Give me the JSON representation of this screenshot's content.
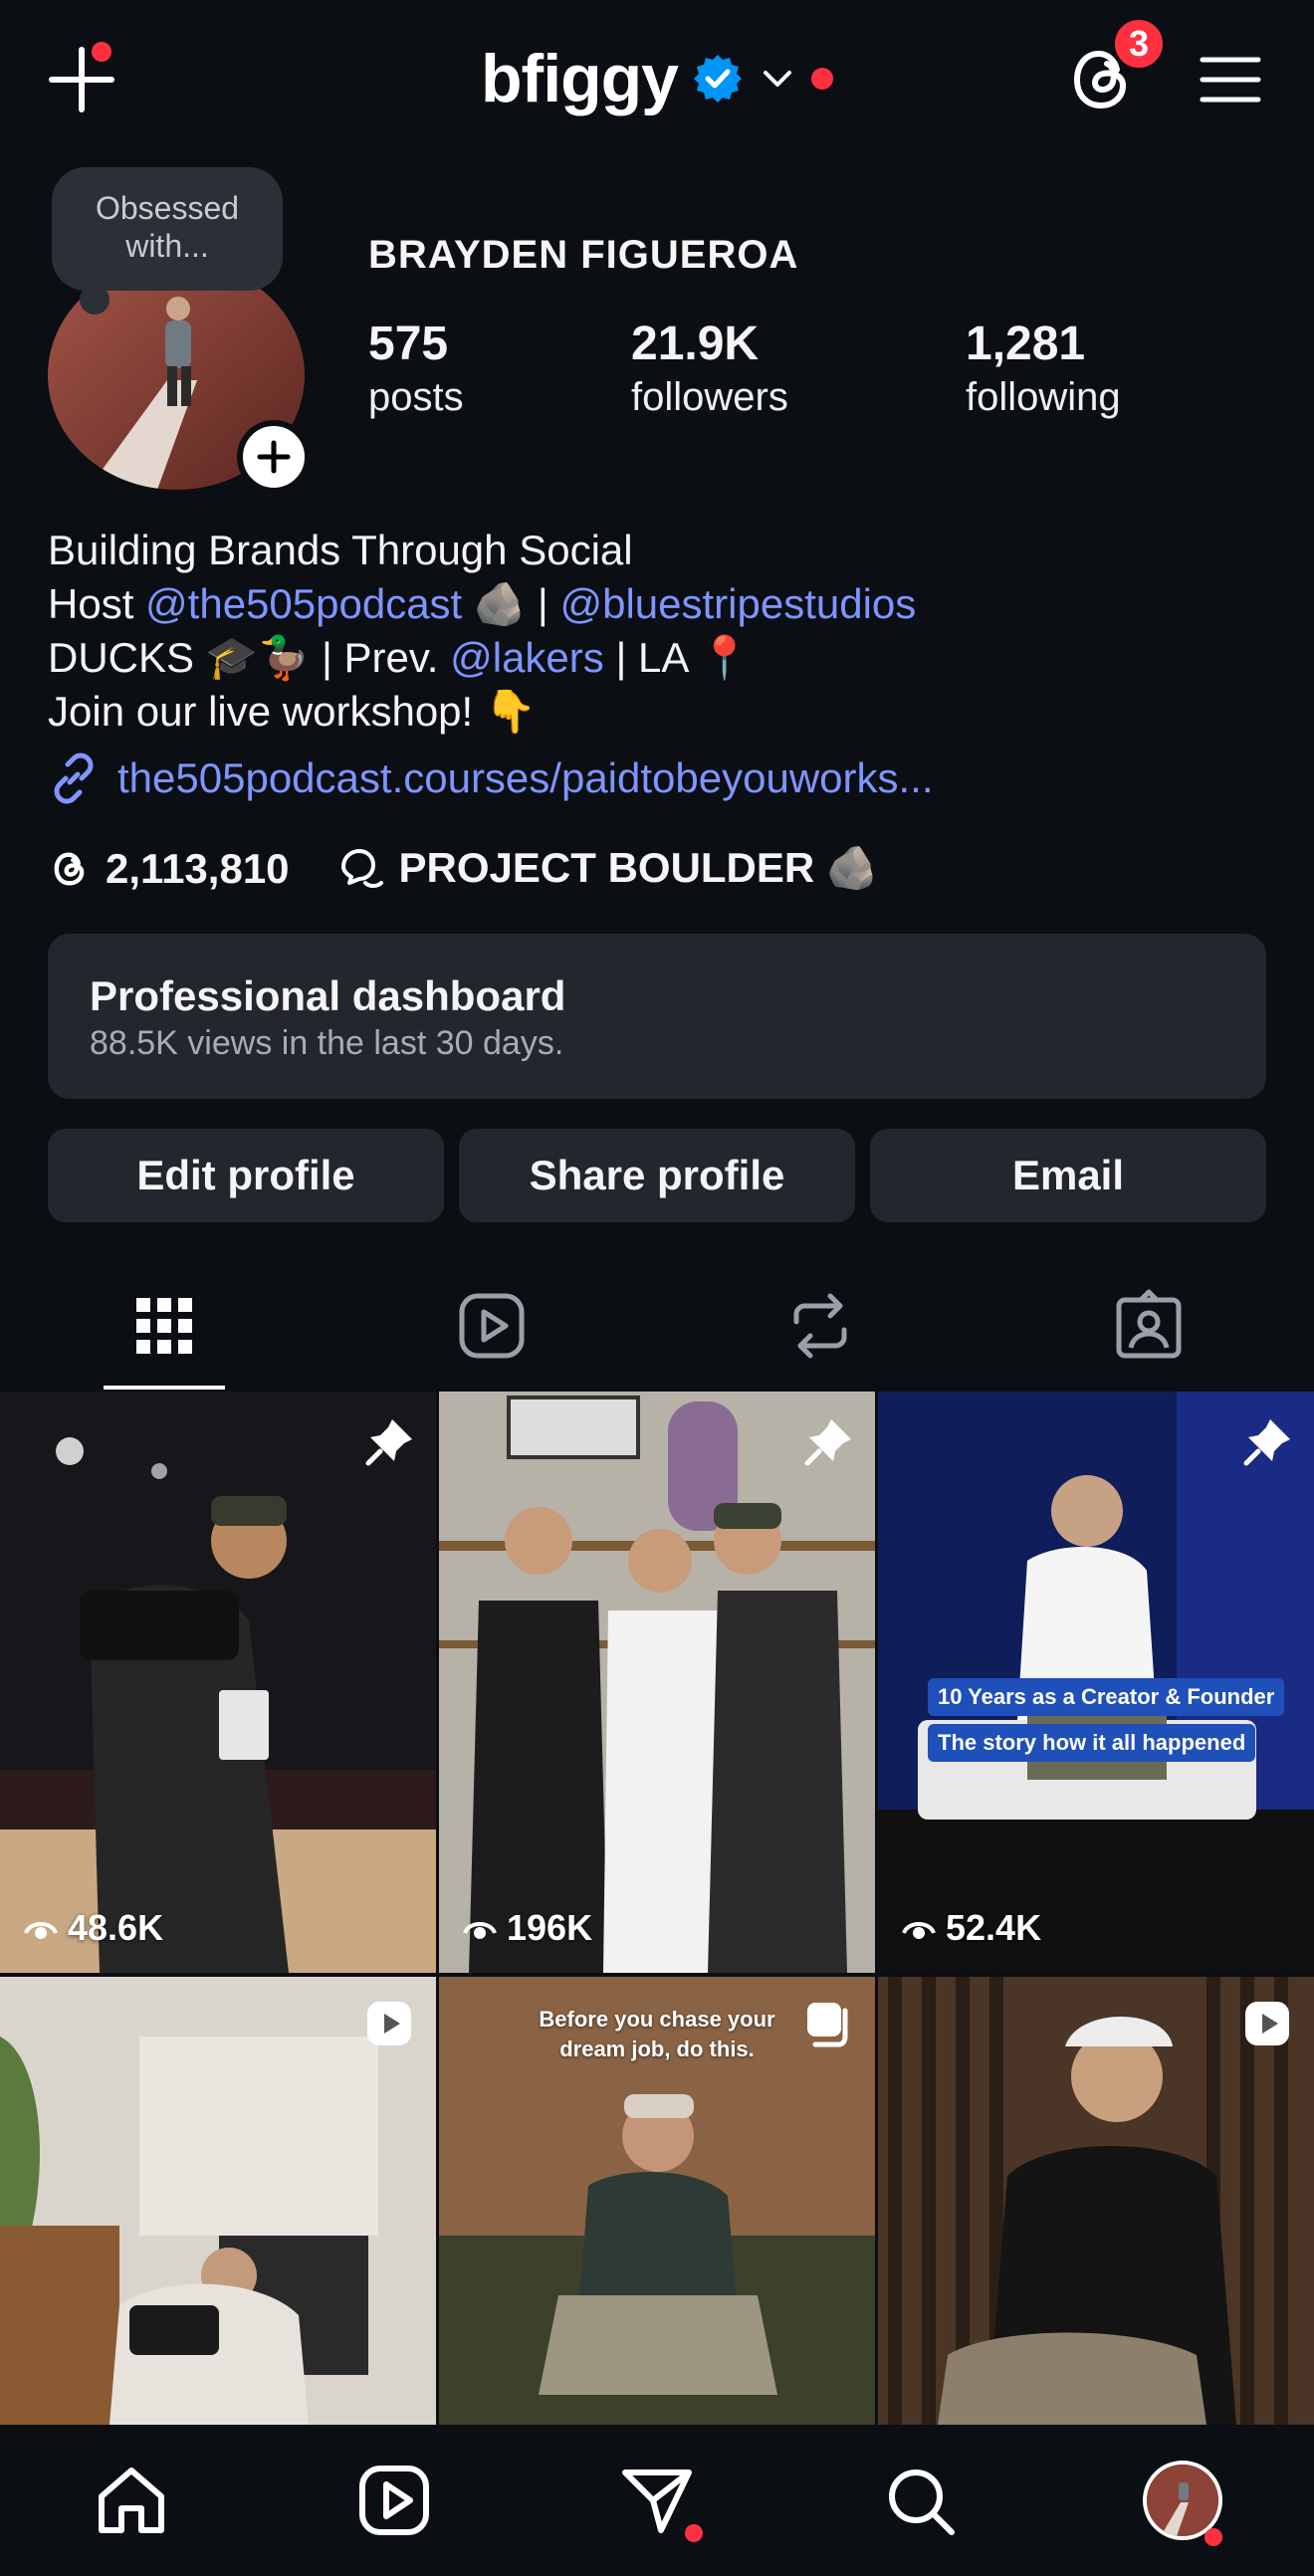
{
  "header": {
    "username": "bfiggy",
    "notification_count": "3",
    "icons": [
      "plus-icon",
      "verified-badge-icon",
      "chevron-down-icon",
      "threads-icon",
      "hamburger-menu-icon"
    ]
  },
  "profile": {
    "note": "Obsessed with...",
    "full_name": "BRAYDEN FIGUEROA",
    "stats": {
      "posts_count": "575",
      "posts_label": "posts",
      "followers_count": "21.9K",
      "followers_label": "followers",
      "following_count": "1,281",
      "following_label": "following"
    }
  },
  "bio": {
    "line1": "Building Brands Through Social",
    "line2_prefix": "Host ",
    "line2_link1": "@the505podcast",
    "line2_emoji1": "🪨",
    "line2_sep": " | ",
    "line2_link2": "@bluestripestudios",
    "line3_prefix": "DUCKS 🎓🦆 | Prev. ",
    "line3_link": "@lakers",
    "line3_suffix": " | LA 📍",
    "line4": "Join our live workshop! 👇",
    "url": "the505podcast.courses/paidtobeyouworks...",
    "threads_count": "2,113,810",
    "channel_name": "PROJECT BOULDER 🪨"
  },
  "dashboard": {
    "title": "Professional dashboard",
    "subtitle": "88.5K views in the last 30 days."
  },
  "buttons": {
    "edit": "Edit profile",
    "share": "Share profile",
    "email": "Email"
  },
  "tabs": [
    "grid-icon",
    "reels-icon",
    "reposts-icon",
    "tagged-icon"
  ],
  "grid": [
    {
      "views": "48.6K",
      "pinned": true
    },
    {
      "views": "196K",
      "pinned": true
    },
    {
      "views": "52.4K",
      "pinned": true,
      "captions": [
        "10 Years as a Creator & Founder",
        "The story how it all happened"
      ]
    },
    {
      "reel": true
    },
    {
      "carousel": true,
      "overlay": "Before you chase your dream job, do this."
    },
    {
      "reel": true
    }
  ],
  "bottom_nav": [
    "home-icon",
    "reels-icon",
    "direct-messages-icon",
    "search-icon",
    "profile-avatar"
  ],
  "colors": {
    "accent_link": "#7f95ff",
    "notification_red": "#ff3040",
    "verified_blue": "#0095f6",
    "surface": "#22272e",
    "background": "#0b0f14"
  }
}
